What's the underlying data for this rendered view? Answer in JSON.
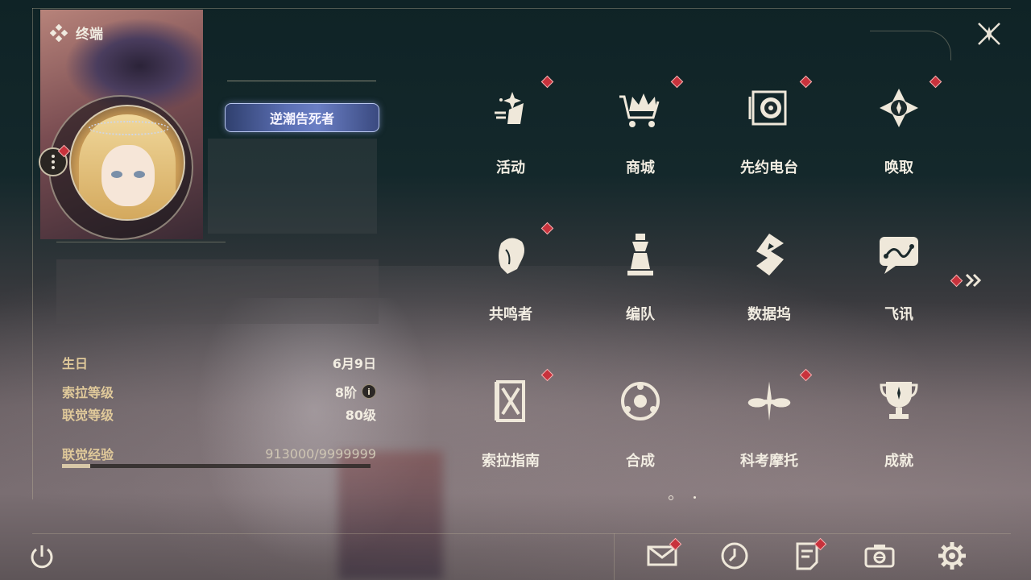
{
  "header": {
    "title": "终端"
  },
  "profile": {
    "title_badge": "逆潮告死者",
    "stats": [
      {
        "label": "生日",
        "value": "6月9日"
      },
      {
        "label": "索拉等级",
        "value": "8阶"
      },
      {
        "label": "联觉等级",
        "value": "80级"
      },
      {
        "label": "联觉经验",
        "value": "913000/9999999"
      }
    ],
    "exp_progress": 0.0913
  },
  "menu": [
    {
      "label": "活动",
      "icon": "event-icon",
      "badge": true
    },
    {
      "label": "商城",
      "icon": "shop-crown-icon",
      "badge": true
    },
    {
      "label": "先约电台",
      "icon": "radio-icon",
      "badge": true
    },
    {
      "label": "唤取",
      "icon": "gacha-compass-icon",
      "badge": true
    },
    {
      "label": "共鸣者",
      "icon": "character-head-icon",
      "badge": true
    },
    {
      "label": "编队",
      "icon": "team-chess-icon",
      "badge": false
    },
    {
      "label": "数据坞",
      "icon": "data-dock-icon",
      "badge": false
    },
    {
      "label": "飞讯",
      "icon": "message-icon",
      "badge": false
    },
    {
      "label": "索拉指南",
      "icon": "guide-book-icon",
      "badge": true
    },
    {
      "label": "合成",
      "icon": "synthesis-icon",
      "badge": false
    },
    {
      "label": "科考摩托",
      "icon": "motorbike-icon",
      "badge": true
    },
    {
      "label": "成就",
      "icon": "trophy-icon",
      "badge": false
    }
  ],
  "pagination": {
    "current": 1,
    "total": 2
  },
  "bottom_bar": [
    "mail-icon",
    "clock-icon",
    "notes-icon",
    "camera-icon",
    "settings-gear-icon"
  ],
  "colors": {
    "accent_gold": "#e0c99a",
    "badge_red": "#c8323c",
    "badge_title_blue": "#5b6fb4"
  }
}
